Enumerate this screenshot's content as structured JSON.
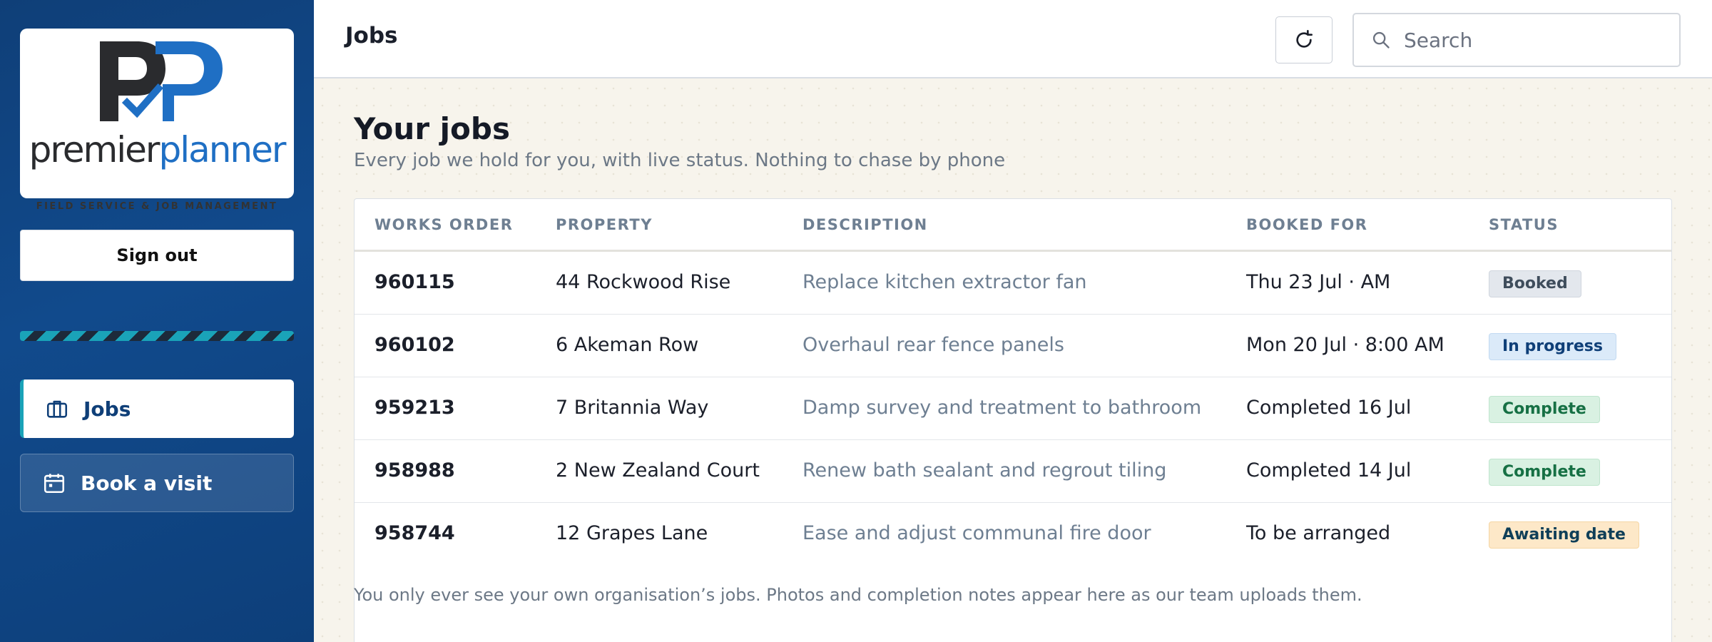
{
  "brand": {
    "name_dark": "premier",
    "name_blue": "planner",
    "tagline": "FIELD SERVICE & JOB MANAGEMENT",
    "logo_icon": "pp-monogram-check-logo",
    "colors": {
      "navy": "#0f3f78",
      "blue": "#1f6fc4",
      "teal": "#1aa3b8"
    }
  },
  "sidebar": {
    "signout_label": "Sign out",
    "items": [
      {
        "label": "Jobs",
        "icon": "briefcase-icon",
        "active": true
      },
      {
        "label": "Book a visit",
        "icon": "calendar-icon",
        "active": false
      }
    ]
  },
  "header": {
    "title": "Jobs",
    "refresh_icon": "refresh-icon",
    "search": {
      "placeholder": "Search",
      "value": ""
    }
  },
  "main": {
    "title": "Your jobs",
    "subtitle": "Every job we hold for you, with live status. Nothing to chase by phone",
    "columns": [
      "WORKS ORDER",
      "PROPERTY",
      "DESCRIPTION",
      "BOOKED FOR",
      "STATUS"
    ],
    "rows": [
      {
        "works_order": "960115",
        "property": "44 Rockwood Rise",
        "description": "Replace kitchen extractor fan",
        "booked_for": "Thu 23 Jul · AM",
        "status": "Booked"
      },
      {
        "works_order": "960102",
        "property": "6 Akeman Row",
        "description": "Overhaul rear fence panels",
        "booked_for": "Mon 20 Jul · 8:00 AM",
        "status": "In progress"
      },
      {
        "works_order": "959213",
        "property": "7 Britannia Way",
        "description": "Damp survey and treatment to bathroom",
        "booked_for": "Completed 16 Jul",
        "status": "Complete"
      },
      {
        "works_order": "958988",
        "property": "2 New Zealand Court",
        "description": "Renew bath sealant and regrout tiling",
        "booked_for": "Completed 14 Jul",
        "status": "Complete"
      },
      {
        "works_order": "958744",
        "property": "12 Grapes Lane",
        "description": "Ease and adjust communal fire door",
        "booked_for": "To be arranged",
        "status": "Awaiting date"
      }
    ],
    "footnote": "You only ever see your own organisation’s jobs. Photos and completion notes appear here as our team uploads them."
  }
}
